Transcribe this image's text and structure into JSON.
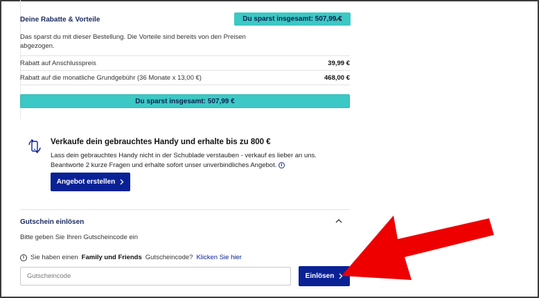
{
  "rabatte": {
    "title": "Deine Rabatte & Vorteile",
    "badge": "Du sparst insgesamt: 507,99 €",
    "description": "Das sparst du mit dieser Bestellung. Die Vorteile sind bereits von den Preisen abgezogen.",
    "rows": [
      {
        "label": "Rabatt auf Anschlusspreis",
        "value": "39,99 €"
      },
      {
        "label": "Rabatt auf die monatliche Grundgebühr (36 Monate x 13,00 €)",
        "value": "468,00 €"
      }
    ],
    "total_bar": "Du sparst insgesamt: 507,99 €"
  },
  "tradein": {
    "title": "Verkaufe dein gebrauchtes Handy und erhalte bis zu 800 €",
    "text": "Lass dein gebrauchtes Handy nicht in der Schublade verstauben - verkauf es lieber an uns. Beantworte 2 kurze Fragen und erhalte sofort unser unverbindliches Angebot.",
    "info_glyph": "i",
    "button": "Angebot erstellen",
    "icon": "phone-recycle-icon"
  },
  "gutschein": {
    "title": "Gutschein einlösen",
    "description": "Bitte geben Sie Ihren Gutscheincode ein",
    "ff_prefix": "Sie haben einen",
    "ff_bold": "Family und Friends",
    "ff_suffix": "Gutscheincode?",
    "ff_link": "Klicken Sie hier",
    "input_placeholder": "Gutscheincode",
    "button": "Einlösen"
  },
  "colors": {
    "accent_teal": "#3cc8c4",
    "primary_blue": "#0a2196",
    "annotation_red": "#ee0000"
  }
}
